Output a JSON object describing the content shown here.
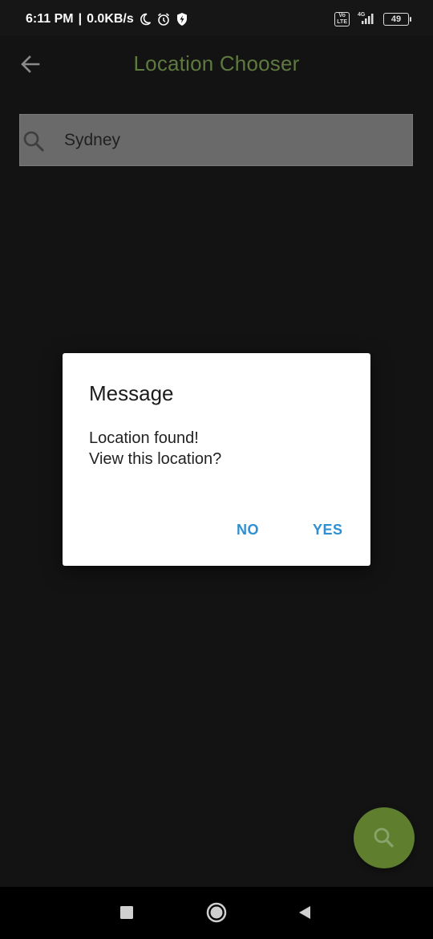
{
  "status_bar": {
    "time": "6:11 PM",
    "separator": "|",
    "speed": "0.0KB/s",
    "network": "4G",
    "volte": "Vo\nLTE",
    "battery": "49"
  },
  "app_bar": {
    "title": "Location Chooser",
    "back_icon": "arrow-left-icon",
    "title_color": "#5e7a3e"
  },
  "search": {
    "value": "Sydney",
    "icon": "search-icon"
  },
  "dialog": {
    "title": "Message",
    "message_line1": "Location found!",
    "message_line2": "View this location?",
    "no_label": "NO",
    "yes_label": "YES",
    "button_color": "#2e8fd3"
  },
  "fab": {
    "icon": "search-icon",
    "color": "#5f7f2f"
  },
  "nav_bar": {
    "recent_icon": "square-icon",
    "home_icon": "circle-icon",
    "back_icon": "triangle-back-icon"
  }
}
